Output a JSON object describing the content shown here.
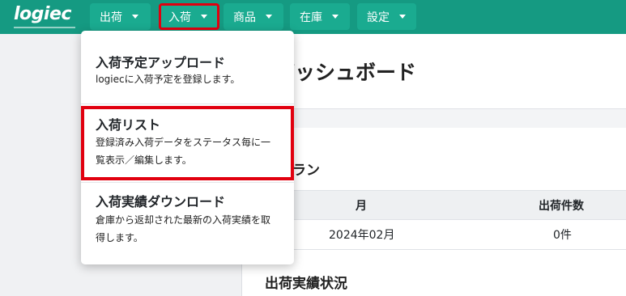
{
  "header": {
    "logo": "logiec",
    "nav": [
      {
        "label": "出荷"
      },
      {
        "label": "入荷"
      },
      {
        "label": "商品"
      },
      {
        "label": "在庫"
      },
      {
        "label": "設定"
      }
    ]
  },
  "dropdown": {
    "items": [
      {
        "title": "入荷予定アップロード",
        "desc": "logiecに入荷予定を登録します。"
      },
      {
        "title": "入荷リスト",
        "desc_line1": "登録済み入荷データをステータス毎に一",
        "desc_line2": "覧表示／編集します。"
      },
      {
        "title": "入荷実績ダウンロード",
        "desc_line1": "倉庫から返却された最新の入荷実績を取",
        "desc_line2": "得します。"
      }
    ]
  },
  "main": {
    "page_title": "ダッシュボード",
    "plan_section": "用プラン",
    "table": {
      "headers": [
        "月",
        "出荷件数"
      ],
      "rows": [
        [
          "2024年02月",
          "0件"
        ]
      ]
    },
    "shipment_section": "出荷実績状況"
  },
  "colors": {
    "navbar": "#159a82",
    "nav_button": "#1aab90",
    "highlight": "#e1000f"
  }
}
